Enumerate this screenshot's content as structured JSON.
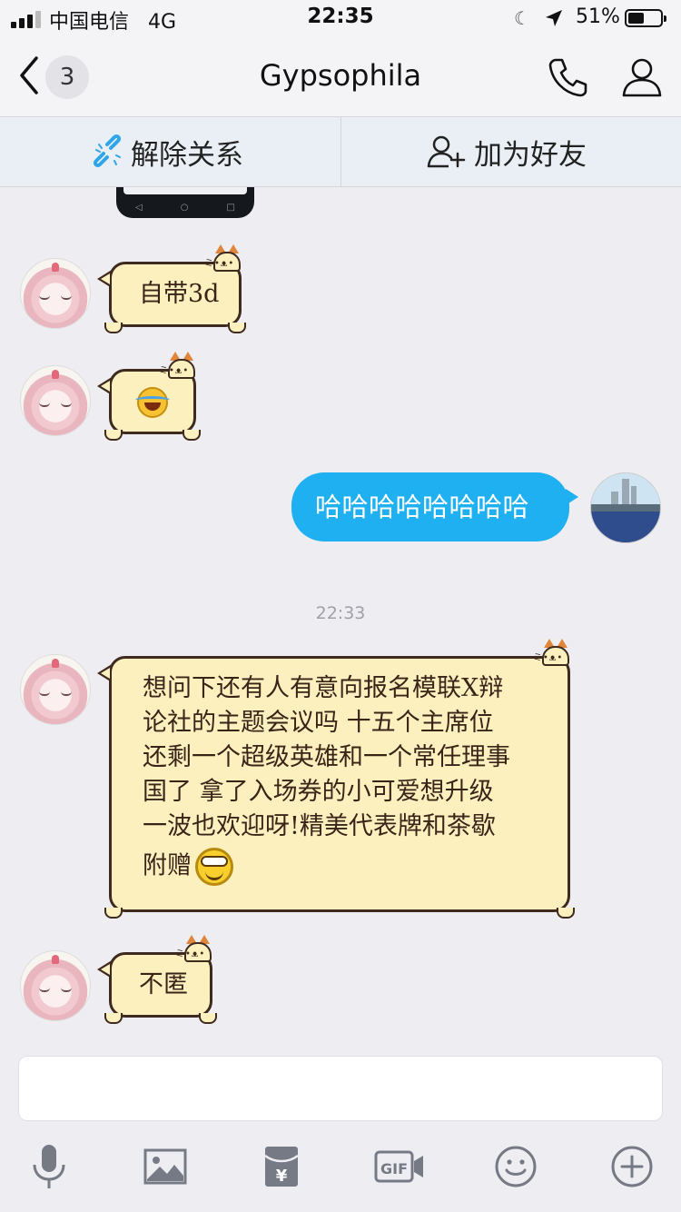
{
  "status_bar": {
    "carrier": "中国电信",
    "network": "4G",
    "time": "22:35",
    "battery_text": "51%",
    "battery_level": 0.51
  },
  "nav": {
    "unread_count": "3",
    "title": "Gypsophila"
  },
  "relation_bar": {
    "unbind_label": "解除关系",
    "add_friend_label": "加为好友"
  },
  "messages": {
    "m1": "自带3d",
    "m3": "哈哈哈哈哈哈哈哈",
    "timestamp": "22:33",
    "m4_lines": [
      "想问下还有人有意向报名模联X辩",
      "论社的主题会议吗 十五个主席位",
      "还剩一个超级英雄和一个常任理事",
      "国了 拿了入场券的小可爱想升级",
      "一波也欢迎呀!精美代表牌和茶歇",
      "附赠"
    ],
    "m5": "不匿"
  },
  "colors": {
    "accent_blue": "#1eb0f0",
    "bubble_fill": "#fdf0bf",
    "bubble_border": "#3e2a1e",
    "background": "#ededf2"
  },
  "toolbar_icons": [
    "microphone-icon",
    "image-icon",
    "red-packet-icon",
    "gif-icon",
    "emoji-icon",
    "plus-icon"
  ]
}
